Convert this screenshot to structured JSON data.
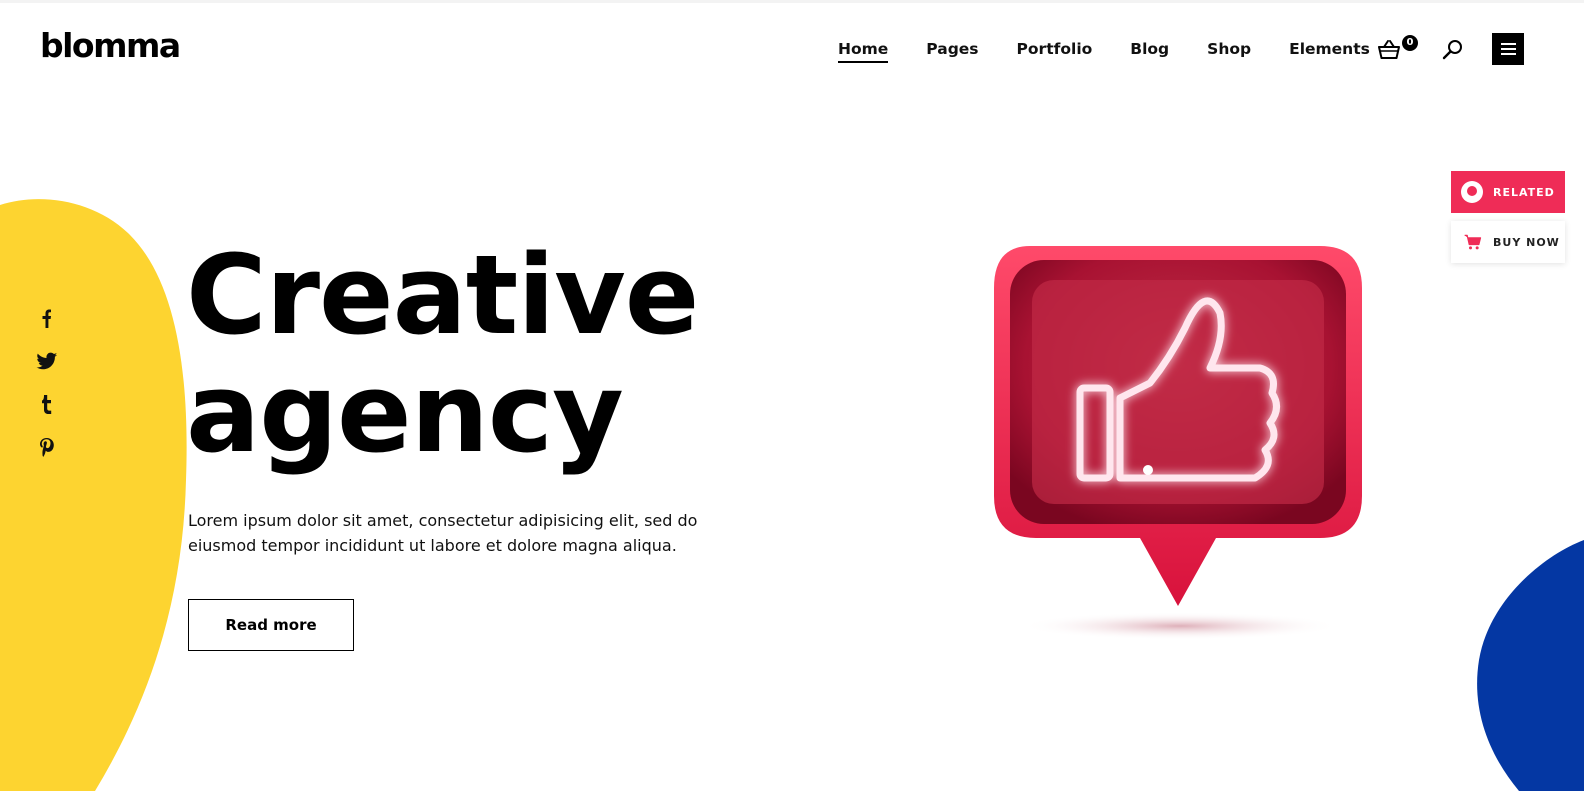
{
  "header": {
    "logo": "blomma",
    "nav": [
      {
        "label": "Home",
        "active": true
      },
      {
        "label": "Pages"
      },
      {
        "label": "Portfolio"
      },
      {
        "label": "Blog"
      },
      {
        "label": "Shop"
      },
      {
        "label": "Elements"
      }
    ],
    "cart_count": "0",
    "icons": [
      "basket-icon",
      "search-icon",
      "hamburger-menu-icon"
    ]
  },
  "social": [
    "facebook-icon",
    "twitter-icon",
    "tumblr-icon",
    "pinterest-icon"
  ],
  "hero": {
    "title_line1": "Creative",
    "title_line2": "agency",
    "text": "Lorem ipsum dolor sit amet, consectetur adipisicing elit, sed do eiusmod tempor incididunt ut labore et dolore magna aliqua.",
    "button": "Read more"
  },
  "side_tabs": {
    "related": "RELATED",
    "buy_now": "BUY NOW"
  },
  "colors": {
    "yellow": "#fdd430",
    "blue": "#0437a3",
    "red": "#ef2c57"
  }
}
